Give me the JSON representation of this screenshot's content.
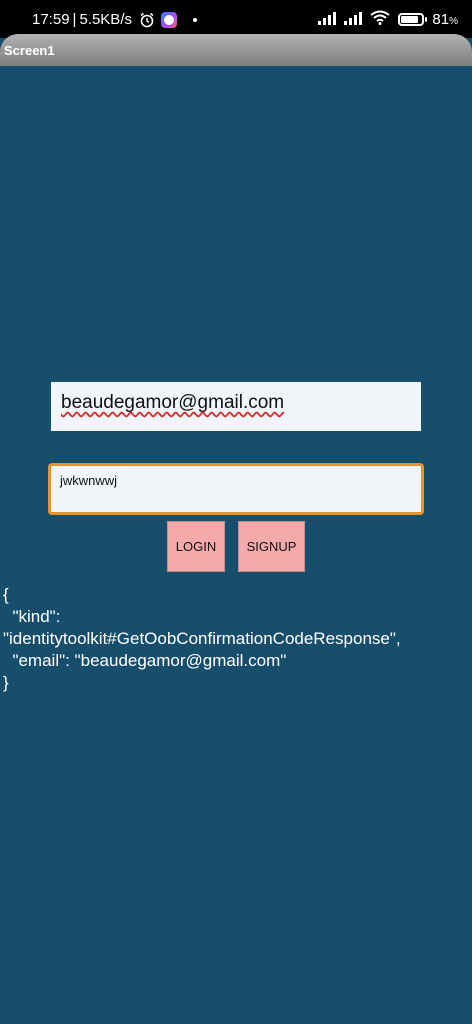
{
  "status_bar": {
    "time": "17:59",
    "separator": "|",
    "speed": "5.5KB/s",
    "battery_percent": "81",
    "battery_unit": "%"
  },
  "app": {
    "title": "Screen1"
  },
  "form": {
    "email_value": "beaudegamor@gmail.com",
    "password_value": "jwkwnwwj",
    "login_label": "LOGIN",
    "signup_label": "SIGNUP"
  },
  "response": {
    "line1": "{",
    "line2": "  \"kind\":",
    "line3": "\"identitytoolkit#GetOobConfirmationCodeResponse\",",
    "line4": "  \"email\": \"beaudegamor@gmail.com\"",
    "line5": "}"
  },
  "colors": {
    "background": "#164e6b",
    "button": "#f4a9aa",
    "focus_border": "#e8932e"
  },
  "icons": [
    "alarm-icon",
    "messenger-icon",
    "notification-dot-icon",
    "signal-icon",
    "wifi-icon",
    "battery-icon"
  ]
}
